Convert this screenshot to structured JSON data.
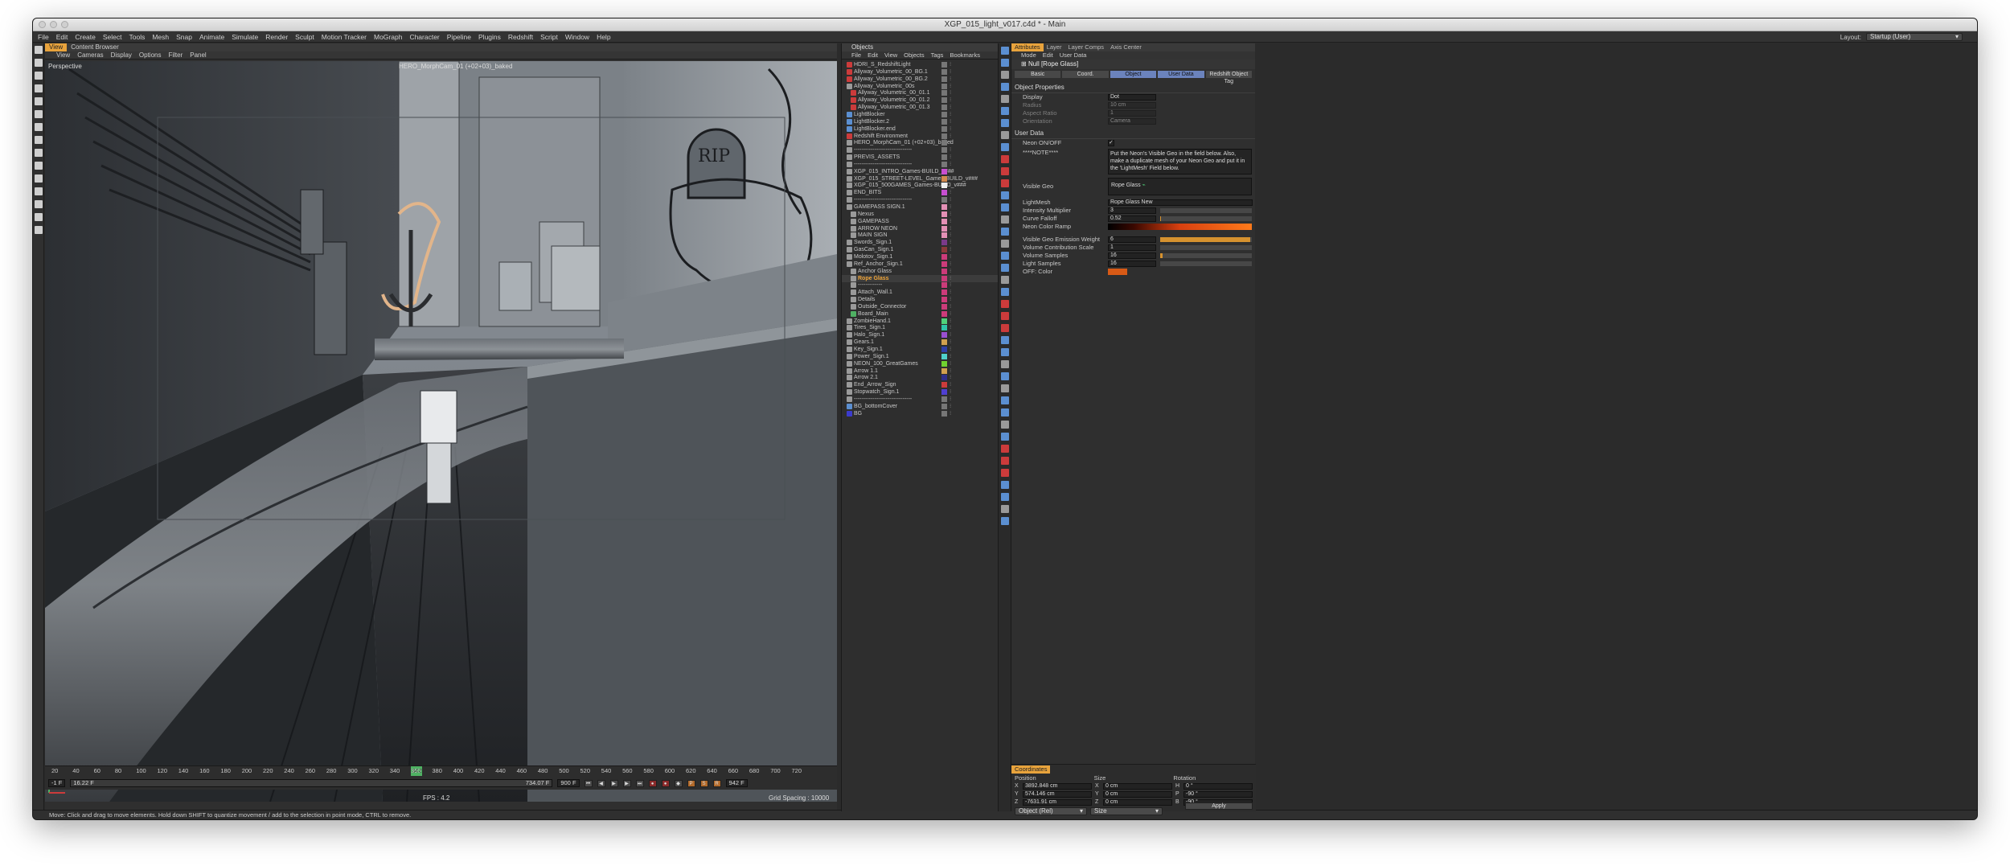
{
  "window": {
    "title": "XGP_015_light_v017.c4d * - Main"
  },
  "menubar": [
    "File",
    "Edit",
    "Create",
    "Select",
    "Tools",
    "Mesh",
    "Snap",
    "Animate",
    "Simulate",
    "Render",
    "Sculpt",
    "Motion Tracker",
    "MoGraph",
    "Character",
    "Pipeline",
    "Plugins",
    "Redshift",
    "Script",
    "Window",
    "Help"
  ],
  "layout": {
    "label": "Layout:",
    "value": "Startup (User)"
  },
  "viewport": {
    "tabs": [
      "View",
      "Content Browser"
    ],
    "menu": [
      "View",
      "Cameras",
      "Display",
      "Options",
      "Filter",
      "Panel"
    ],
    "view_name": "Perspective",
    "camera": "HERO_MorphCam_01 (+02+03)_baked",
    "fps": "FPS : 4.2",
    "grid": "Grid Spacing : 10000 cm",
    "sign_text": "RIP"
  },
  "timeline": {
    "ticks": [
      "20",
      "40",
      "60",
      "80",
      "100",
      "120",
      "140",
      "160",
      "180",
      "200",
      "220",
      "240",
      "260",
      "280",
      "300",
      "320",
      "340",
      "360",
      "380",
      "400",
      "420",
      "440",
      "460",
      "480",
      "500",
      "520",
      "540",
      "560",
      "580",
      "600",
      "620",
      "640",
      "660",
      "680",
      "700",
      "720"
    ],
    "current": "342",
    "end_frame": "942 F",
    "start_field": "-1 F",
    "range_start": "16.22 F",
    "range_end": "734.07 F",
    "max_field": "900 F"
  },
  "status_text": "Move: Click and drag to move elements. Hold down SHIFT to quantize movement / add to the selection in point mode, CTRL to remove.",
  "objects": {
    "title": "Objects",
    "menu": [
      "File",
      "Edit",
      "View",
      "Objects",
      "Tags",
      "Bookmarks"
    ],
    "rows": [
      {
        "name": "HDRI_S_RedshiftLight",
        "indent": 0,
        "icon": "#cc3b3b",
        "color": "#777"
      },
      {
        "name": "Allyway_Volumetric_00_BG.1",
        "indent": 0,
        "icon": "#cc3b3b",
        "color": "#777"
      },
      {
        "name": "Allyway_Volumetric_00_BG.2",
        "indent": 0,
        "icon": "#cc3b3b",
        "color": "#777"
      },
      {
        "name": "Allyway_Volumetric_00s",
        "indent": 0,
        "icon": "#9a9a9a",
        "color": "#777"
      },
      {
        "name": "Allyway_Volumetric_00_01.1",
        "indent": 1,
        "icon": "#cc3b3b",
        "color": "#777"
      },
      {
        "name": "Allyway_Volumetric_00_01.2",
        "indent": 1,
        "icon": "#cc3b3b",
        "color": "#777"
      },
      {
        "name": "Allyway_Volumetric_00_01.3",
        "indent": 1,
        "icon": "#cc3b3b",
        "color": "#777"
      },
      {
        "name": "LightBlocker",
        "indent": 0,
        "icon": "#5b8fd1",
        "color": "#777"
      },
      {
        "name": "LightBlocker.2",
        "indent": 0,
        "icon": "#5b8fd1",
        "color": "#777"
      },
      {
        "name": "LightBlocker.end",
        "indent": 0,
        "icon": "#5b8fd1",
        "color": "#777"
      },
      {
        "name": "Redshift Environment",
        "indent": 0,
        "icon": "#cc3b3b",
        "color": "#777"
      },
      {
        "name": "HERO_MorphCam_01 (+02+03)_baked",
        "indent": 0,
        "icon": "#9a9a9a",
        "color": "#777"
      },
      {
        "name": "-------------------------------",
        "indent": 0,
        "icon": "#9a9a9a",
        "color": "#777"
      },
      {
        "name": "PREVIS_ASSETS",
        "indent": 0,
        "icon": "#9a9a9a",
        "color": "#777"
      },
      {
        "name": "-------------------------------",
        "indent": 0,
        "icon": "#9a9a9a",
        "color": "#777"
      },
      {
        "name": "XGP_015_INTRO_Games-BUILD_v###",
        "indent": 0,
        "icon": "#9a9a9a",
        "color": "#c84fd1"
      },
      {
        "name": "XGP_015_STREET-LEVEL_Games-BUILD_v###",
        "indent": 0,
        "icon": "#9a9a9a",
        "color": "#d18a4f"
      },
      {
        "name": "XGP_015_500GAMES_Games-BUILD_v###",
        "indent": 0,
        "icon": "#9a9a9a",
        "color": "#eeeeee"
      },
      {
        "name": "END_BITS",
        "indent": 0,
        "icon": "#9a9a9a",
        "color": "#c84fd1"
      },
      {
        "name": "-------------------------------",
        "indent": 0,
        "icon": "#9a9a9a",
        "color": "#777"
      },
      {
        "name": "GAMEPASS SIGN.1",
        "indent": 0,
        "icon": "#9a9a9a",
        "color": "#e38fb5"
      },
      {
        "name": "Nexus",
        "indent": 1,
        "icon": "#9a9a9a",
        "color": "#e38fb5"
      },
      {
        "name": "GAMEPASS",
        "indent": 1,
        "icon": "#9a9a9a",
        "color": "#e38fb5"
      },
      {
        "name": "ARROW NEON",
        "indent": 1,
        "icon": "#9a9a9a",
        "color": "#e38fb5"
      },
      {
        "name": "MAIN SIGN",
        "indent": 1,
        "icon": "#9a9a9a",
        "color": "#e38fb5"
      },
      {
        "name": "Swords_Sign.1",
        "indent": 0,
        "icon": "#9a9a9a",
        "color": "#7a3a8a"
      },
      {
        "name": "GasCan_Sign.1",
        "indent": 0,
        "icon": "#9a9a9a",
        "color": "#8a3a3a"
      },
      {
        "name": "Molotov_Sign.1",
        "indent": 0,
        "icon": "#9a9a9a",
        "color": "#cc3b7a"
      },
      {
        "name": "Ref_Anchor_Sign.1",
        "indent": 0,
        "icon": "#9a9a9a",
        "color": "#cc3b7a"
      },
      {
        "name": "Anchor Glass",
        "indent": 1,
        "icon": "#9a9a9a",
        "color": "#cc3b7a"
      },
      {
        "name": "Rope Glass",
        "indent": 1,
        "icon": "#9a9a9a",
        "color": "#cc3b7a"
      },
      {
        "name": "-------------",
        "indent": 1,
        "icon": "#9a9a9a",
        "color": "#cc3b7a"
      },
      {
        "name": "Attach_Wall.1",
        "indent": 1,
        "icon": "#9a9a9a",
        "color": "#cc3b7a"
      },
      {
        "name": "Details",
        "indent": 1,
        "icon": "#9a9a9a",
        "color": "#cc3b7a"
      },
      {
        "name": "Outside_Connector",
        "indent": 1,
        "icon": "#9a9a9a",
        "color": "#cc3b7a"
      },
      {
        "name": "Board_Main",
        "indent": 1,
        "icon": "#4fb163",
        "color": "#cc3b7a"
      },
      {
        "name": "ZombieHand.1",
        "indent": 0,
        "icon": "#9a9a9a",
        "color": "#4fd17a"
      },
      {
        "name": "Tires_Sign.1",
        "indent": 0,
        "icon": "#9a9a9a",
        "color": "#2fc4a8"
      },
      {
        "name": "Halo_Sign.1",
        "indent": 0,
        "icon": "#9a9a9a",
        "color": "#9a4fd1"
      },
      {
        "name": "Gears.1",
        "indent": 0,
        "icon": "#9a9a9a",
        "color": "#d1a04f"
      },
      {
        "name": "Key_Sign.1",
        "indent": 0,
        "icon": "#9a9a9a",
        "color": "#2f3fa8"
      },
      {
        "name": "Power_Sign.1",
        "indent": 0,
        "icon": "#9a9a9a",
        "color": "#4fd1cc"
      },
      {
        "name": "NEON_100_GreatGames",
        "indent": 0,
        "icon": "#9a9a9a",
        "color": "#6fd12f"
      },
      {
        "name": "Arrow 1.1",
        "indent": 0,
        "icon": "#9a9a9a",
        "color": "#d1a04f"
      },
      {
        "name": "Arrow 2.1",
        "indent": 0,
        "icon": "#9a9a9a",
        "color": "#2f2f8a"
      },
      {
        "name": "End_Arrow_Sign",
        "indent": 0,
        "icon": "#9a9a9a",
        "color": "#cc3b3b"
      },
      {
        "name": "Stopwatch_Sign.1",
        "indent": 0,
        "icon": "#9a9a9a",
        "color": "#4f3fd1"
      },
      {
        "name": "-------------------------------",
        "indent": 0,
        "icon": "#9a9a9a",
        "color": "#777"
      },
      {
        "name": "BG_bottomCover",
        "indent": 0,
        "icon": "#5b8fd1",
        "color": "#777"
      },
      {
        "name": "BG",
        "indent": 0,
        "icon": "#3b3bcc",
        "color": "#777"
      }
    ],
    "selected": "Rope Glass"
  },
  "attributes": {
    "tabs": [
      "Attributes",
      "Layer",
      "Layer Comps",
      "Axis Center"
    ],
    "menu": [
      "Mode",
      "Edit",
      "User Data"
    ],
    "object": "Null [Rope Glass]",
    "buttons": [
      "Basic",
      "Coord.",
      "Object",
      "User Data",
      "Redshift Object Tag"
    ],
    "section1": "Object Properties",
    "props": [
      {
        "label": "Display",
        "value": "Dot"
      },
      {
        "label": "Radius",
        "value": "10 cm"
      },
      {
        "label": "Aspect Ratio",
        "value": "1"
      },
      {
        "label": "Orientation",
        "value": "Camera"
      }
    ],
    "section2": "User Data",
    "neon_label": "Neon ON/OFF",
    "note_label": "****NOTE****",
    "note_text": "Put the Neon's Visible Geo in the field below. Also, make a duplicate mesh of your Neon Geo and put it in the 'LightMesh' Field below.",
    "visible_geo": {
      "label": "Visible Geo",
      "value": "Rope Glass"
    },
    "lightmesh": {
      "label": "LightMesh",
      "value": "Rope Glass New"
    },
    "sliders": [
      {
        "label": "Intensity Multiplier",
        "value": "3",
        "fill": 0
      },
      {
        "label": "Curve Falloff",
        "value": "0.52",
        "fill": 0.01
      }
    ],
    "ramp_label": "Neon Color Ramp",
    "sliders2": [
      {
        "label": "Visible Geo Emission Weight",
        "value": "6",
        "fill": 0.98
      },
      {
        "label": "Volume Contribution Scale",
        "value": "1",
        "fill": 0
      },
      {
        "label": "Volume Samples",
        "value": "16",
        "fill": 0.03
      },
      {
        "label": "Light Samples",
        "value": "16",
        "fill": 0
      }
    ],
    "off_color_label": "OFF: Color",
    "off_color": "#d85a16"
  },
  "coordinates": {
    "tab": "Coordinates",
    "headers": [
      "Position",
      "Size",
      "Rotation"
    ],
    "rows": [
      {
        "a": "X",
        "p": "3892.848 cm",
        "b": "X",
        "s": "0 cm",
        "c": "H",
        "r": "0 °"
      },
      {
        "a": "Y",
        "p": "574.146 cm",
        "b": "Y",
        "s": "0 cm",
        "c": "P",
        "r": "-90 °"
      },
      {
        "a": "Z",
        "p": "-7631.91 cm",
        "b": "Z",
        "s": "0 cm",
        "c": "B",
        "r": "-90 °"
      }
    ],
    "mode1": "Object (Rel)",
    "mode2": "Size",
    "apply": "Apply"
  }
}
